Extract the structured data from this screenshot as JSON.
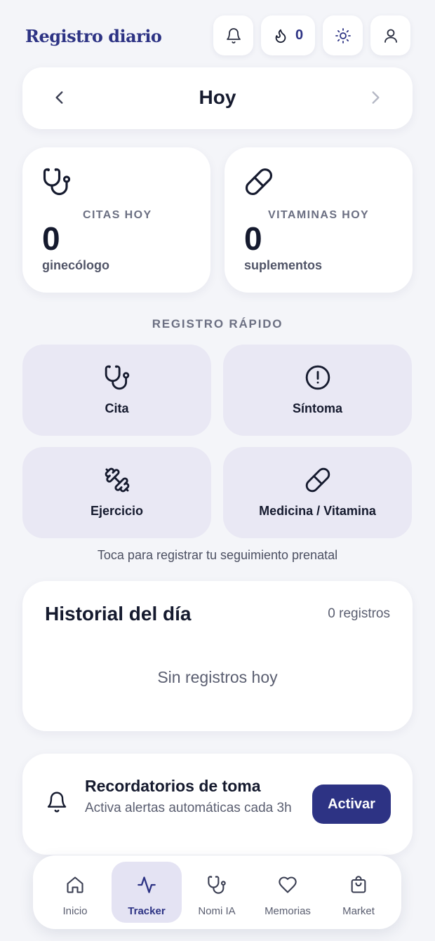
{
  "header": {
    "title": "Registro diario",
    "streak_count": "0",
    "icons": [
      "bell-icon",
      "flame-icon",
      "sun-icon",
      "user-icon"
    ]
  },
  "date_nav": {
    "title": "Hoy"
  },
  "stats": [
    {
      "icon": "stethoscope-icon",
      "label": "CITAS HOY",
      "value": "0",
      "unit": "ginecólogo"
    },
    {
      "icon": "pill-icon",
      "label": "VITAMINAS HOY",
      "value": "0",
      "unit": "suplementos"
    }
  ],
  "quick_log": {
    "title": "REGISTRO RÁPIDO",
    "items": [
      {
        "icon": "stethoscope-icon",
        "label": "Cita"
      },
      {
        "icon": "alert-circle-icon",
        "label": "Síntoma"
      },
      {
        "icon": "dumbbell-icon",
        "label": "Ejercicio"
      },
      {
        "icon": "pill-icon",
        "label": "Medicina / Vitamina"
      }
    ],
    "hint": "Toca para registrar tu seguimiento prenatal"
  },
  "history": {
    "title": "Historial del día",
    "count": "0 registros",
    "empty": "Sin registros hoy"
  },
  "reminder": {
    "icon": "bell-icon",
    "title": "Recordatorios de toma",
    "description": "Activa alertas automáticas cada 3h",
    "button": "Activar"
  },
  "bottom_nav": {
    "items": [
      {
        "icon": "home-icon",
        "label": "Inicio"
      },
      {
        "icon": "activity-icon",
        "label": "Tracker",
        "active": true
      },
      {
        "icon": "stethoscope-icon",
        "label": "Nomi IA"
      },
      {
        "icon": "heart-icon",
        "label": "Memorias"
      },
      {
        "icon": "shopping-bag-icon",
        "label": "Market"
      }
    ]
  },
  "colors": {
    "brand": "#2d3384",
    "background": "#f4f5f9",
    "quick_tile": "#e9e8f4",
    "active_nav": "#e4e3f3"
  }
}
